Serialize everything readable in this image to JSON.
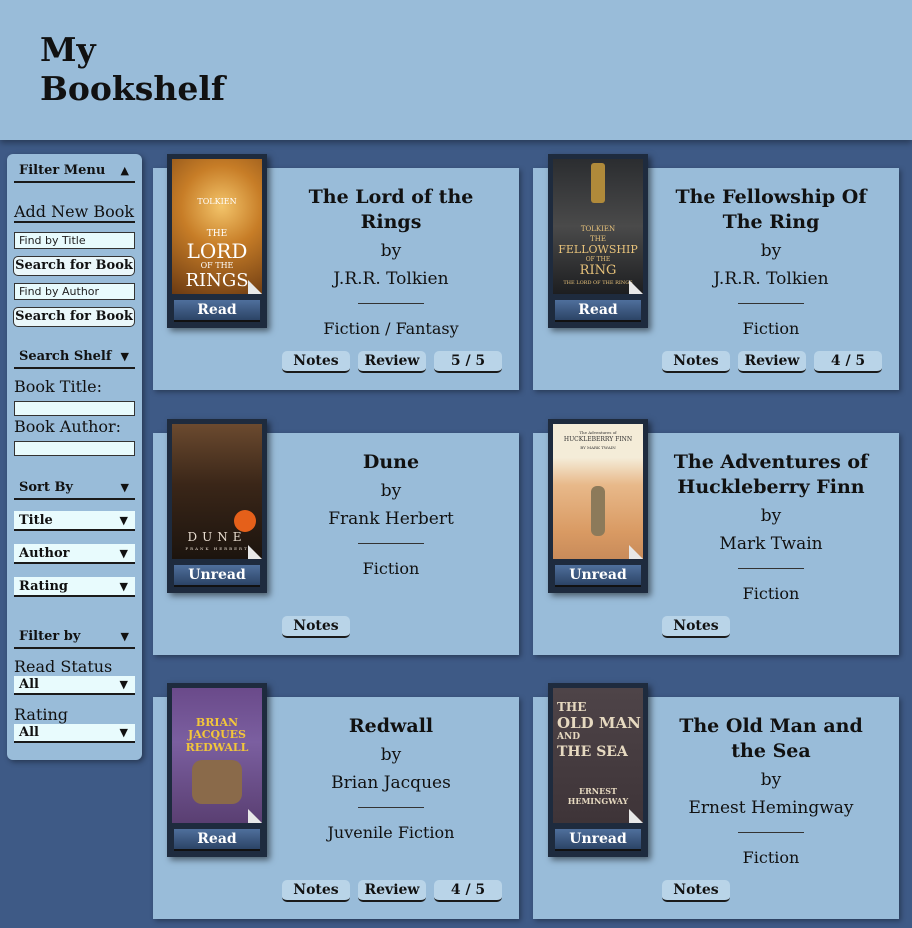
{
  "header": {
    "title_line1": "My",
    "title_line2": "Bookshelf"
  },
  "sidebar": {
    "filter_menu": "Filter Menu",
    "add_new_book": "Add New Book",
    "find_by_title_placeholder": "Find by Title",
    "search_for_book": "Search for Book",
    "find_by_author_placeholder": "Find by Author",
    "search_shelf": "Search Shelf",
    "book_title_label": "Book Title:",
    "book_author_label": "Book Author:",
    "sort_by": "Sort By",
    "sort_options": [
      "Title",
      "Author",
      "Rating"
    ],
    "filter_by": "Filter by",
    "read_status_label": "Read Status",
    "read_status_value": "All",
    "rating_label": "Rating",
    "rating_value": "All"
  },
  "books": [
    {
      "title": "The Lord of the Rings",
      "by": "by",
      "author": "J.R.R. Tolkien",
      "genre": "Fiction / Fantasy",
      "status": "Read",
      "notes": "Notes",
      "review": "Review",
      "rating": "5 / 5",
      "cover_text": [
        "TOLKIEN",
        "THE",
        "LORD",
        "OF THE",
        "RINGS"
      ]
    },
    {
      "title": "The Fellowship Of The Ring",
      "by": "by",
      "author": "J.R.R. Tolkien",
      "genre": "Fiction",
      "status": "Read",
      "notes": "Notes",
      "review": "Review",
      "rating": "4 / 5",
      "cover_text": [
        "TOLKIEN",
        "THE",
        "FELLOWSHIP",
        "OF THE",
        "RING",
        "THE LORD OF THE RINGS"
      ]
    },
    {
      "title": "Dune",
      "by": "by",
      "author": "Frank Herbert",
      "genre": "Fiction",
      "status": "Unread",
      "notes": "Notes",
      "cover_text": [
        "DUNE",
        "FRANK HERBERT"
      ]
    },
    {
      "title": "The Adventures of Huckleberry Finn",
      "by": "by",
      "author": "Mark Twain",
      "genre": "Fiction",
      "status": "Unread",
      "notes": "Notes",
      "cover_text": [
        "The Adventures of",
        "HUCKLEBERRY FINN",
        "BY MARK TWAIN"
      ]
    },
    {
      "title": "Redwall",
      "by": "by",
      "author": "Brian Jacques",
      "genre": "Juvenile Fiction",
      "status": "Read",
      "notes": "Notes",
      "review": "Review",
      "rating": "4 / 5",
      "cover_text": [
        "BRIAN",
        "JACQUES",
        "REDWALL"
      ]
    },
    {
      "title": "The Old Man and the Sea",
      "by": "by",
      "author": "Ernest Hemingway",
      "genre": "Fiction",
      "status": "Unread",
      "notes": "Notes",
      "cover_text": [
        "THE",
        "OLD MAN",
        "AND",
        "THE SEA",
        "ERNEST",
        "HEMINGWAY"
      ]
    }
  ],
  "colors": {
    "background": "#3e5a86",
    "panel": "#99bcd9",
    "input": "#e8fbfd",
    "button_dark": "#2c4466"
  }
}
